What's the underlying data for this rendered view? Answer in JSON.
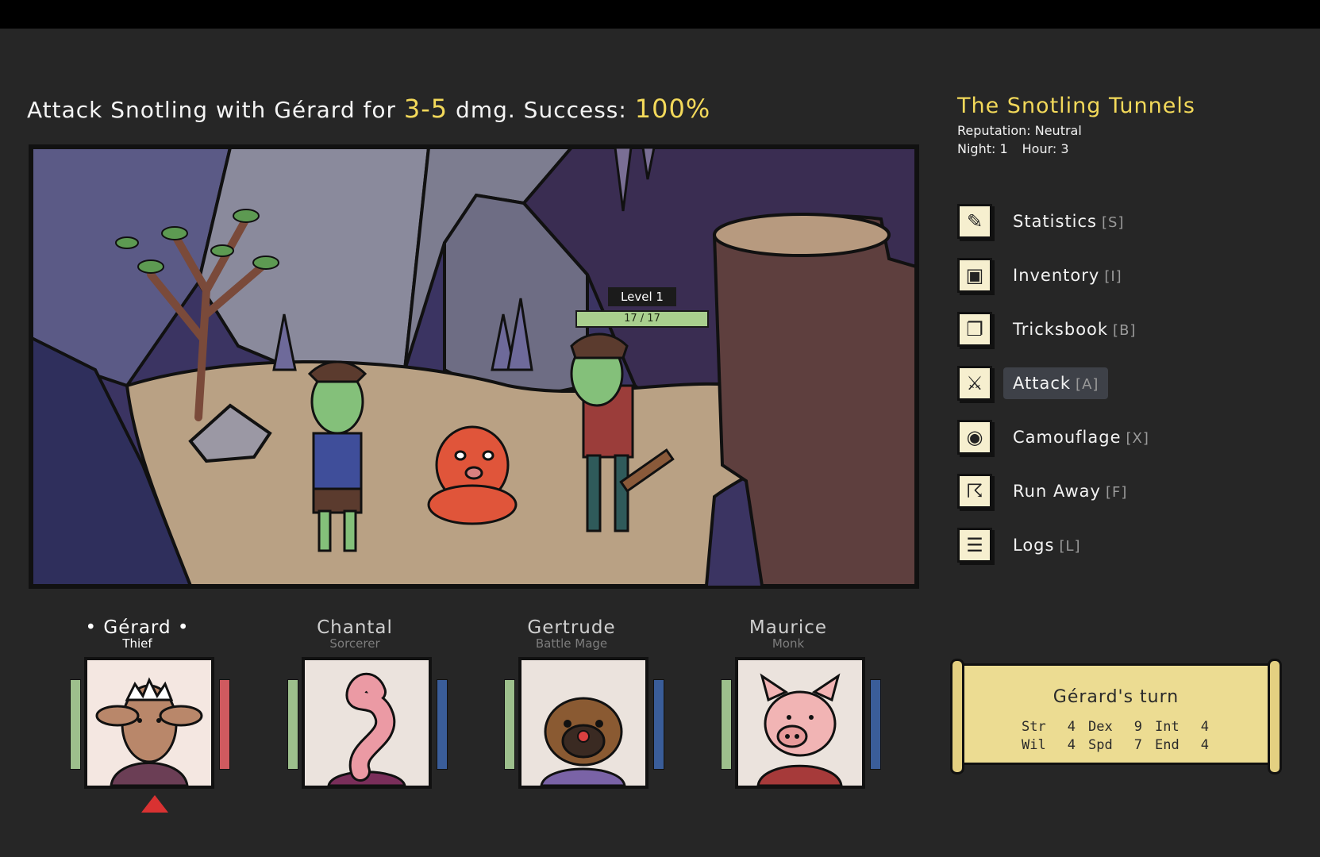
{
  "action_line": {
    "prefix": "Attack Snotling with Gérard for ",
    "damage": "3-5",
    "middle": " dmg. Success: ",
    "success": "100%"
  },
  "enemy": {
    "level_label": "Level 1",
    "hp": "17 / 17",
    "hp_fraction": 1.0
  },
  "location": {
    "title": "The Snotling Tunnels",
    "reputation": "Reputation: Neutral",
    "night": "Night: 1",
    "hour": "Hour: 3"
  },
  "menu": [
    {
      "label": "Statistics",
      "key": "[S]",
      "icon": "scroll-quill-icon"
    },
    {
      "label": "Inventory",
      "key": "[I]",
      "icon": "chest-icon"
    },
    {
      "label": "Tricksbook",
      "key": "[B]",
      "icon": "spellbook-icon"
    },
    {
      "label": "Attack",
      "key": "[A]",
      "icon": "sword-icon"
    },
    {
      "label": "Camouflage",
      "key": "[X]",
      "icon": "mask-icon"
    },
    {
      "label": "Run Away",
      "key": "[F]",
      "icon": "running-man-icon"
    },
    {
      "label": "Logs",
      "key": "[L]",
      "icon": "parchment-icon"
    }
  ],
  "party": [
    {
      "name": "• Gérard •",
      "class": "Thief",
      "portrait": "sheep",
      "current": true,
      "right_bar_color": "#d05a5f"
    },
    {
      "name": "Chantal",
      "class": "Sorcerer",
      "portrait": "worm",
      "current": false,
      "right_bar_color": "#3a5d99"
    },
    {
      "name": "Gertrude",
      "class": "Battle Mage",
      "portrait": "pug",
      "current": false,
      "right_bar_color": "#3a5d99"
    },
    {
      "name": "Maurice",
      "class": "Monk",
      "portrait": "pig",
      "current": false,
      "right_bar_color": "#3a5d99"
    }
  ],
  "turn_panel": {
    "title": "Gérard's turn",
    "stats": [
      [
        [
          "Str",
          "4"
        ],
        [
          "Dex",
          "9"
        ],
        [
          "Int",
          "4"
        ]
      ],
      [
        [
          "Wil",
          "4"
        ],
        [
          "Spd",
          "7"
        ],
        [
          "End",
          "4"
        ]
      ]
    ]
  },
  "colors": {
    "highlight": "#f3d95a",
    "background": "#262626",
    "menu_active": "#3e4148"
  }
}
